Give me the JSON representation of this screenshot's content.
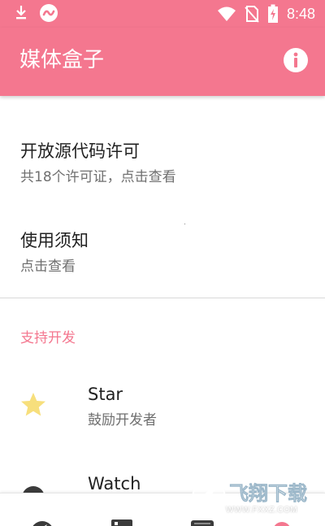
{
  "status_bar": {
    "time": "8:48",
    "left_icons": [
      "download-icon",
      "app-notification-icon"
    ],
    "right_icons": [
      "wifi-icon",
      "no-sim-icon",
      "battery-charging-icon"
    ]
  },
  "app_bar": {
    "title": "媒体盒子",
    "action_icon": "info-icon",
    "color": "#f4778f"
  },
  "items": [
    {
      "title": "开放源代码许可",
      "subtitle": "共18个许可证，点击查看"
    },
    {
      "title": "使用须知",
      "subtitle": "点击查看"
    }
  ],
  "support_section": {
    "header": "支持开发",
    "header_color": "#f4778f",
    "items": [
      {
        "icon": "star-icon",
        "title": "Star",
        "subtitle": "鼓励开发者"
      },
      {
        "icon": "eye-icon",
        "title": "Watch"
      }
    ]
  },
  "bottom_nav": {
    "items": [
      "compass-icon",
      "image-icon",
      "inbox-icon",
      "gear-icon"
    ]
  },
  "watermark": {
    "logo": "飞翔下载",
    "domain": "WWW.FXXZ.COM"
  }
}
